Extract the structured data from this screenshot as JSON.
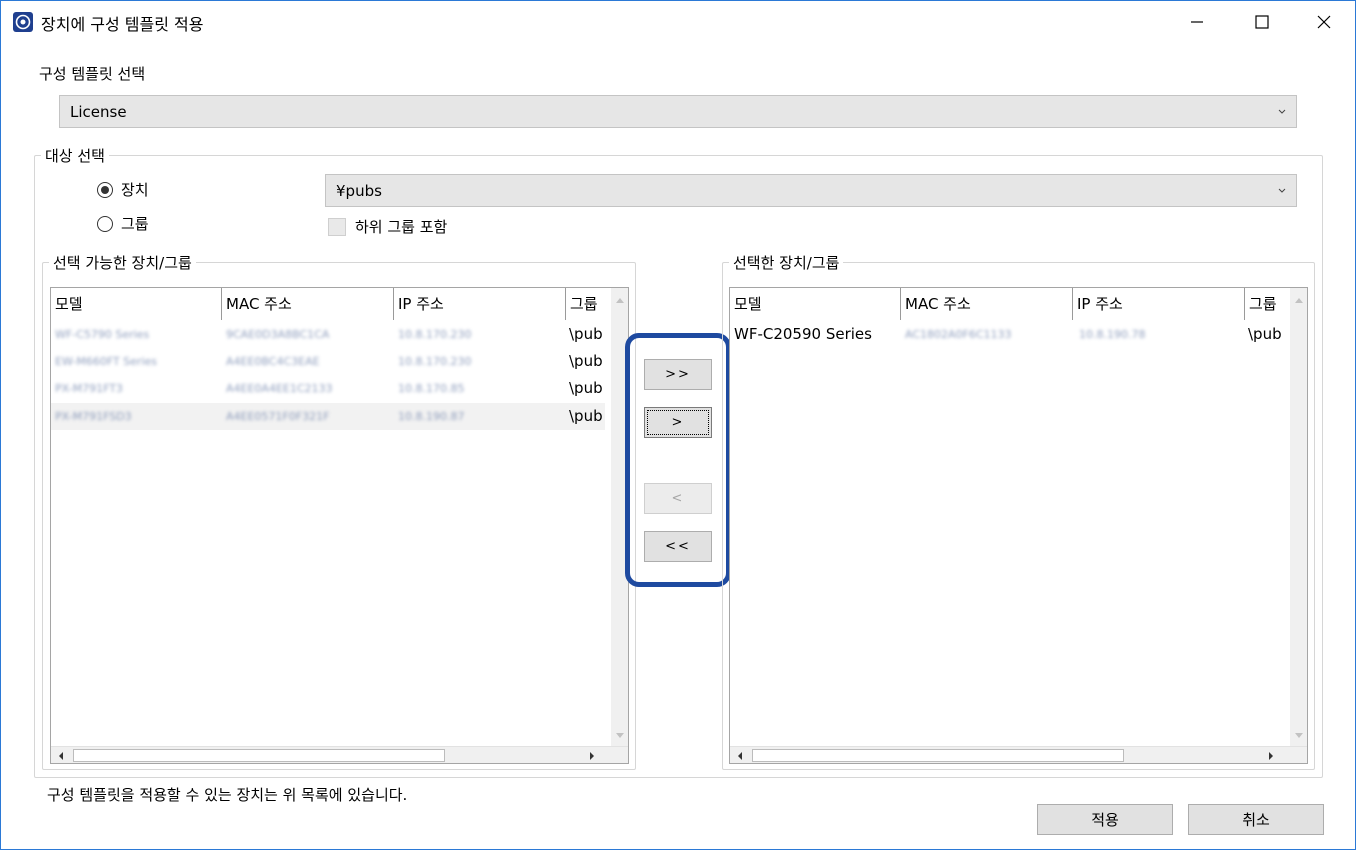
{
  "window": {
    "title": "장치에 구성 템플릿 적용",
    "icon": "epson-app-icon"
  },
  "template_section": {
    "label": "구성 템플릿 선택",
    "selected": "License"
  },
  "target_section": {
    "label": "대상 선택",
    "radio_device": "장치",
    "radio_group": "그룹",
    "selected_radio": "device",
    "path_value": "¥pubs",
    "include_subgroups_label": "하위 그룹 포함",
    "include_subgroups_checked": false
  },
  "available": {
    "title": "선택 가능한 장치/그룹",
    "columns": [
      "모델",
      "MAC 주소",
      "IP 주소",
      "그룹"
    ],
    "rows": [
      {
        "model": "WF-C5790 Series",
        "mac": "9CAE0D3A8BC1CA",
        "ip": "10.8.170.230",
        "group": "\\pub"
      },
      {
        "model": "EW-M660FT Series",
        "mac": "A4EE0BC4C3EAE",
        "ip": "10.8.170.230",
        "group": "\\pub"
      },
      {
        "model": "PX-M791FT3",
        "mac": "A4EE0A4EE1C2133",
        "ip": "10.8.170.85",
        "group": "\\pub"
      },
      {
        "model": "PX-M791FSD3",
        "mac": "A4EE0571F0F321F",
        "ip": "10.8.190.87",
        "group": "\\pub"
      }
    ]
  },
  "selected": {
    "title": "선택한 장치/그룹",
    "columns": [
      "모델",
      "MAC 주소",
      "IP 주소",
      "그룹"
    ],
    "rows": [
      {
        "model": "WF-C20590 Series",
        "mac": "AC1802A0F6C1133",
        "ip": "10.8.190.78",
        "group": "\\pub"
      }
    ]
  },
  "transfer_buttons": {
    "add_all": ">>",
    "add_one": ">",
    "remove_one": "<",
    "remove_all": "<<"
  },
  "footer": {
    "message": "구성 템플릿을 적용할 수 있는 장치는 위 목록에 있습니다.",
    "apply": "적용",
    "cancel": "취소"
  },
  "colors": {
    "highlight": "#1e4aa0",
    "window_border": "#2b79d6"
  }
}
